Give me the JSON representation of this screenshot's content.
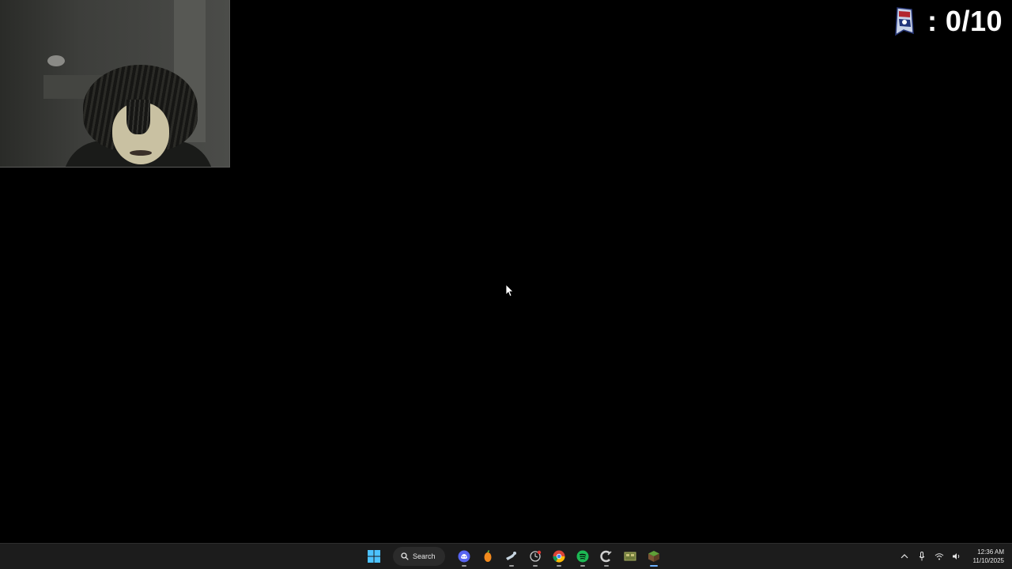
{
  "counter": {
    "value": ": 0/10",
    "icon": "flag-badge-icon"
  },
  "taskbar": {
    "search_label": "Search",
    "apps": [
      {
        "name": "discord",
        "color": "#5865f2"
      },
      {
        "name": "fruity-app",
        "color": "#f28a1d"
      },
      {
        "name": "steam",
        "color": "#c7d5e0"
      },
      {
        "name": "timer-app",
        "color": "#c9c9c9"
      },
      {
        "name": "chrome",
        "color": "#fbbc05"
      },
      {
        "name": "spotify",
        "color": "#1db954"
      },
      {
        "name": "ccleaner",
        "color": "#d0d0d0"
      },
      {
        "name": "gallery-app",
        "color": "#6e7a3a"
      },
      {
        "name": "minecraft",
        "color": "#5fa038"
      }
    ],
    "clock": {
      "time": "12:36 AM",
      "date": "11/10/2025"
    }
  },
  "colors": {
    "taskbar_bg": "#1c1c1c",
    "accent": "#6fb3ff"
  }
}
